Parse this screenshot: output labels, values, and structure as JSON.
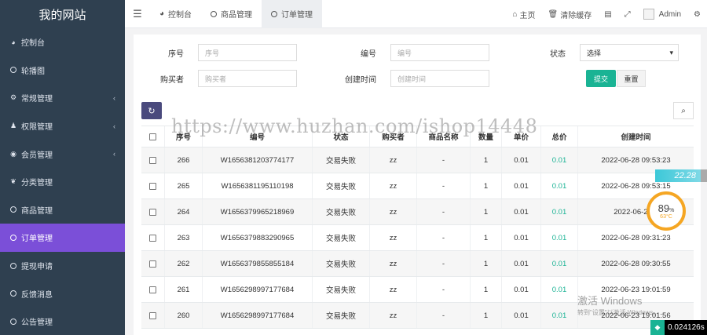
{
  "sidebar": {
    "brand": "我的网站",
    "items": [
      {
        "label": "控制台",
        "icon": "dashboard-icon",
        "glyph": "◕",
        "chevron": false,
        "active": false
      },
      {
        "label": "轮播图",
        "icon": "circle-icon",
        "glyph": "",
        "chevron": false,
        "active": false
      },
      {
        "label": "常规管理",
        "icon": "cogs-icon",
        "glyph": "⚙",
        "chevron": true,
        "active": false
      },
      {
        "label": "权限管理",
        "icon": "group-icon",
        "glyph": "♟",
        "chevron": true,
        "active": false
      },
      {
        "label": "会员管理",
        "icon": "user-circle-icon",
        "glyph": "◉",
        "chevron": true,
        "active": false
      },
      {
        "label": "分类管理",
        "icon": "leaf-icon",
        "glyph": "❦",
        "chevron": false,
        "active": false
      },
      {
        "label": "商品管理",
        "icon": "circle-icon",
        "glyph": "",
        "chevron": false,
        "active": false
      },
      {
        "label": "订单管理",
        "icon": "circle-icon",
        "glyph": "",
        "chevron": false,
        "active": true
      },
      {
        "label": "提现申请",
        "icon": "circle-icon",
        "glyph": "",
        "chevron": false,
        "active": false
      },
      {
        "label": "反馈消息",
        "icon": "circle-icon",
        "glyph": "",
        "chevron": false,
        "active": false
      },
      {
        "label": "公告管理",
        "icon": "circle-icon",
        "glyph": "",
        "chevron": false,
        "active": false
      }
    ]
  },
  "topbar": {
    "tabs": [
      {
        "label": "控制台",
        "icon": "dashboard-icon"
      },
      {
        "label": "商品管理",
        "icon": "circle-icon"
      },
      {
        "label": "订单管理",
        "icon": "circle-icon"
      }
    ],
    "home": "主页",
    "clear_cache": "清除缓存",
    "admin": "Admin"
  },
  "filters": {
    "serial_label": "序号",
    "serial_placeholder": "序号",
    "number_label": "编号",
    "number_placeholder": "编号",
    "status_label": "状态",
    "status_value": "选择",
    "buyer_label": "购买者",
    "buyer_placeholder": "购买者",
    "created_label": "创建时间",
    "created_placeholder": "创建时间",
    "submit": "提交",
    "reset": "重置"
  },
  "table": {
    "headers": [
      "序号",
      "编号",
      "状态",
      "购买者",
      "商品名称",
      "数量",
      "单价",
      "总价",
      "创建时间"
    ],
    "rows": [
      {
        "id": "266",
        "no": "W1656381203774177",
        "status": "交易失败",
        "buyer": "zz",
        "name": "-",
        "qty": "1",
        "price": "0.01",
        "total": "0.01",
        "time": "2022-06-28 09:53:23"
      },
      {
        "id": "265",
        "no": "W1656381195110198",
        "status": "交易失败",
        "buyer": "zz",
        "name": "-",
        "qty": "1",
        "price": "0.01",
        "total": "0.01",
        "time": "2022-06-28 09:53:15"
      },
      {
        "id": "264",
        "no": "W1656379965218969",
        "status": "交易失败",
        "buyer": "zz",
        "name": "-",
        "qty": "1",
        "price": "0.01",
        "total": "0.01",
        "time": "2022-06-28 0"
      },
      {
        "id": "263",
        "no": "W1656379883290965",
        "status": "交易失败",
        "buyer": "zz",
        "name": "-",
        "qty": "1",
        "price": "0.01",
        "total": "0.01",
        "time": "2022-06-28 09:31:23"
      },
      {
        "id": "262",
        "no": "W1656379855855184",
        "status": "交易失败",
        "buyer": "zz",
        "name": "-",
        "qty": "1",
        "price": "0.01",
        "total": "0.01",
        "time": "2022-06-28 09:30:55"
      },
      {
        "id": "261",
        "no": "W1656298997177684",
        "status": "交易失败",
        "buyer": "zz",
        "name": "-",
        "qty": "1",
        "price": "0.01",
        "total": "0.01",
        "time": "2022-06-23 19:01:59"
      },
      {
        "id": "260",
        "no": "W1656298997177684",
        "status": "交易失败",
        "buyer": "zz",
        "name": "-",
        "qty": "1",
        "price": "0.01",
        "total": "0.01",
        "time": "2022-06-23 19:01:56"
      }
    ]
  },
  "overlays": {
    "watermark": "https://www.huzhan.com/ishop14448",
    "speed": "22.28",
    "gauge_pct": "89",
    "gauge_unit": "%",
    "gauge_temp": "63°C",
    "activate_title": "激活 Windows",
    "activate_sub": "转到\"设置\"以激活 Windows。",
    "timer": "0.024126s"
  },
  "colors": {
    "sidebar": "#2f4050",
    "active": "#7b4fd8",
    "primary": "#1ab394",
    "refresh": "#4a4a7d"
  }
}
